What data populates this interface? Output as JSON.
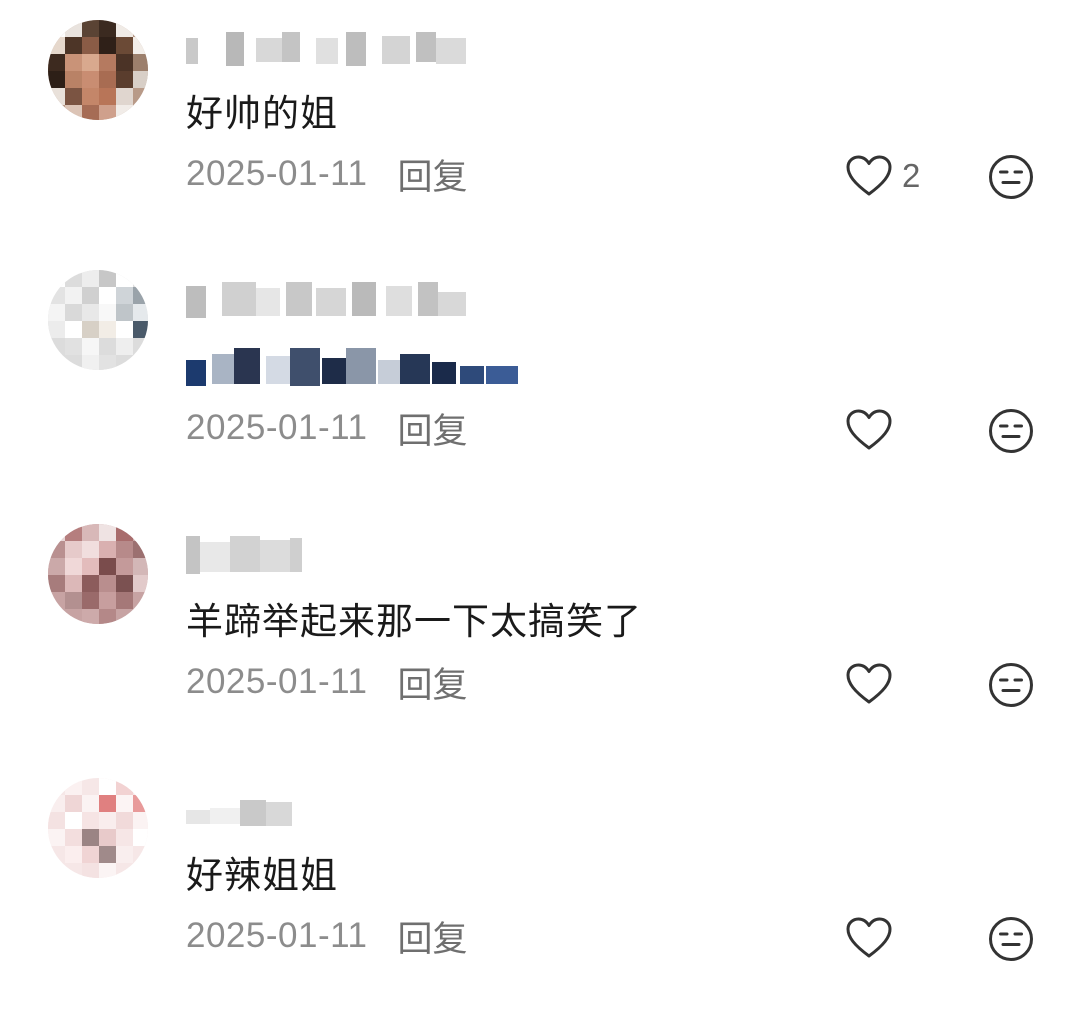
{
  "comments": [
    {
      "text": "好帅的姐",
      "date": "2025-01-11",
      "reply_label": "回复",
      "like_count": "2"
    },
    {
      "text": "",
      "date": "2025-01-11",
      "reply_label": "回复",
      "like_count": ""
    },
    {
      "text": "羊蹄举起来那一下太搞笑了",
      "date": "2025-01-11",
      "reply_label": "回复",
      "like_count": ""
    },
    {
      "text": "好辣姐姐",
      "date": "2025-01-11",
      "reply_label": "回复",
      "like_count": ""
    }
  ],
  "icons": {
    "like": "heart-outline-icon",
    "dislike": "neutral-face-icon"
  },
  "colors": {
    "text": "#1a1a1a",
    "meta": "#8c8c8c",
    "icon": "#333333"
  }
}
